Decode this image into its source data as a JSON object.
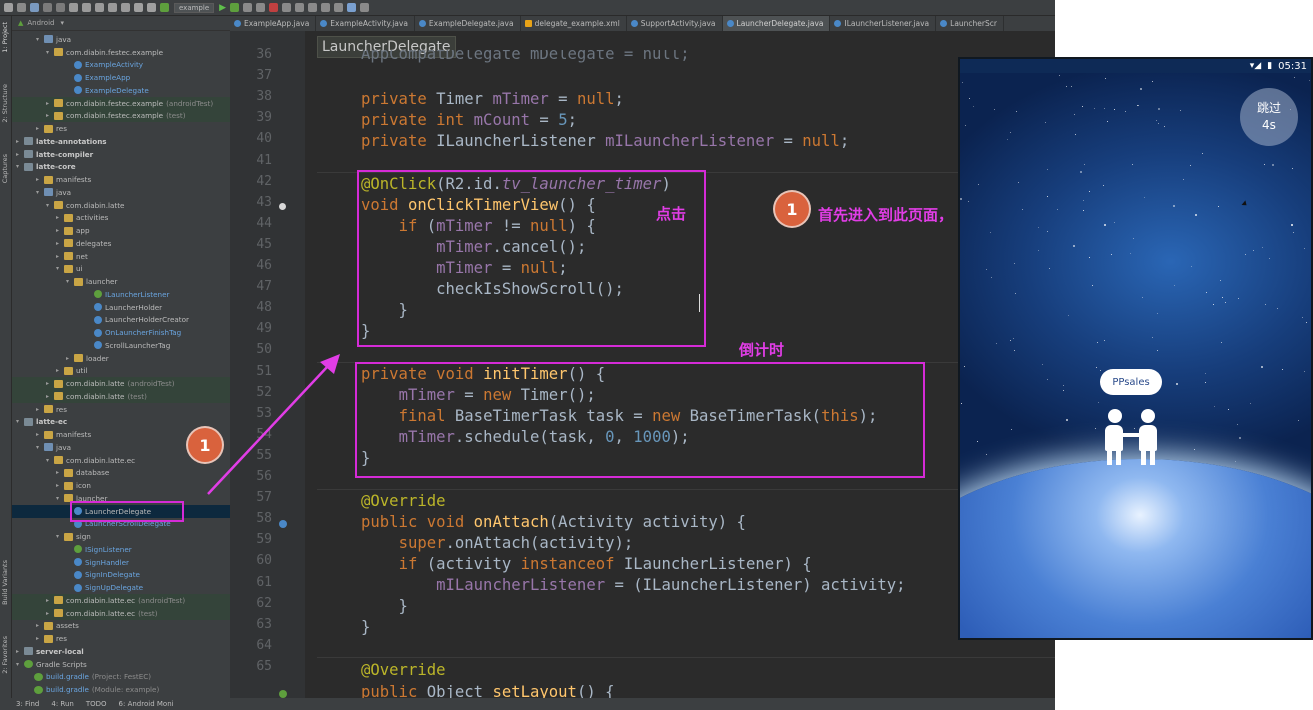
{
  "toolbar": {
    "project": "example"
  },
  "tabs": [
    {
      "label": "ExampleApp.java",
      "kind": "java"
    },
    {
      "label": "ExampleActivity.java",
      "kind": "java"
    },
    {
      "label": "ExampleDelegate.java",
      "kind": "java"
    },
    {
      "label": "delegate_example.xml",
      "kind": "xml"
    },
    {
      "label": "SupportActivity.java",
      "kind": "java"
    },
    {
      "label": "LauncherDelegate.java",
      "kind": "java",
      "active": true
    },
    {
      "label": "ILauncherListener.java",
      "kind": "java"
    },
    {
      "label": "LauncherScr",
      "kind": "java"
    }
  ],
  "left_strip": {
    "project": "1: Project",
    "structure": "2: Structure",
    "captures": "Captures",
    "build_variants": "Build Variants",
    "favorites": "2: Favorites"
  },
  "project_header": "Android",
  "tree": [
    {
      "label": "java",
      "depth": 2,
      "icon": "folder-blue",
      "exp": "down"
    },
    {
      "label": "com.diabin.festec.example",
      "depth": 3,
      "icon": "folder",
      "exp": "down"
    },
    {
      "label": "ExampleActivity",
      "depth": 5,
      "icon": "class",
      "color": "blue"
    },
    {
      "label": "ExampleApp",
      "depth": 5,
      "icon": "class",
      "color": "blue"
    },
    {
      "label": "ExampleDelegate",
      "depth": 5,
      "icon": "class",
      "color": "blue"
    },
    {
      "label": "com.diabin.festec.example",
      "suffix": "(androidTest)",
      "depth": 3,
      "icon": "folder",
      "exp": "right",
      "bg": "test"
    },
    {
      "label": "com.diabin.festec.example",
      "suffix": "(test)",
      "depth": 3,
      "icon": "folder",
      "exp": "right",
      "bg": "test"
    },
    {
      "label": "res",
      "depth": 2,
      "icon": "folder",
      "exp": "right"
    },
    {
      "label": "latte-annotations",
      "depth": 0,
      "icon": "module",
      "exp": "right",
      "bold": true
    },
    {
      "label": "latte-compiler",
      "depth": 0,
      "icon": "module",
      "exp": "right",
      "bold": true
    },
    {
      "label": "latte-core",
      "depth": 0,
      "icon": "module",
      "exp": "down",
      "bold": true
    },
    {
      "label": "manifests",
      "depth": 2,
      "icon": "folder",
      "exp": "right"
    },
    {
      "label": "java",
      "depth": 2,
      "icon": "folder-blue",
      "exp": "down"
    },
    {
      "label": "com.diabin.latte",
      "depth": 3,
      "icon": "folder",
      "exp": "down"
    },
    {
      "label": "activities",
      "depth": 4,
      "icon": "folder",
      "exp": "right"
    },
    {
      "label": "app",
      "depth": 4,
      "icon": "folder",
      "exp": "right"
    },
    {
      "label": "delegates",
      "depth": 4,
      "icon": "folder",
      "exp": "right"
    },
    {
      "label": "net",
      "depth": 4,
      "icon": "folder",
      "exp": "right"
    },
    {
      "label": "ui",
      "depth": 4,
      "icon": "folder",
      "exp": "down"
    },
    {
      "label": "launcher",
      "depth": 5,
      "icon": "folder",
      "exp": "down"
    },
    {
      "label": "ILauncherListener",
      "depth": 7,
      "icon": "interface",
      "color": "blue"
    },
    {
      "label": "LauncherHolder",
      "depth": 7,
      "icon": "class"
    },
    {
      "label": "LauncherHolderCreator",
      "depth": 7,
      "icon": "class"
    },
    {
      "label": "OnLauncherFinishTag",
      "depth": 7,
      "icon": "class",
      "color": "blue"
    },
    {
      "label": "ScrollLauncherTag",
      "depth": 7,
      "icon": "class"
    },
    {
      "label": "loader",
      "depth": 5,
      "icon": "folder",
      "exp": "right"
    },
    {
      "label": "util",
      "depth": 4,
      "icon": "folder",
      "exp": "right"
    },
    {
      "label": "com.diabin.latte",
      "suffix": "(androidTest)",
      "depth": 3,
      "icon": "folder",
      "exp": "right",
      "bg": "test"
    },
    {
      "label": "com.diabin.latte",
      "suffix": "(test)",
      "depth": 3,
      "icon": "folder",
      "exp": "right",
      "bg": "test"
    },
    {
      "label": "res",
      "depth": 2,
      "icon": "folder",
      "exp": "right"
    },
    {
      "label": "latte-ec",
      "depth": 0,
      "icon": "module",
      "exp": "down",
      "bold": true
    },
    {
      "label": "manifests",
      "depth": 2,
      "icon": "folder",
      "exp": "right"
    },
    {
      "label": "java",
      "depth": 2,
      "icon": "folder-blue",
      "exp": "down"
    },
    {
      "label": "com.diabin.latte.ec",
      "depth": 3,
      "icon": "folder",
      "exp": "down"
    },
    {
      "label": "database",
      "depth": 4,
      "icon": "folder",
      "exp": "right"
    },
    {
      "label": "icon",
      "depth": 4,
      "icon": "folder",
      "exp": "right"
    },
    {
      "label": "launcher",
      "depth": 4,
      "icon": "folder",
      "exp": "down"
    },
    {
      "label": "LauncherDelegate",
      "depth": 5,
      "icon": "class",
      "selected": true
    },
    {
      "label": "LauncherScrollDelegate",
      "depth": 5,
      "icon": "class",
      "color": "blue"
    },
    {
      "label": "sign",
      "depth": 4,
      "icon": "folder",
      "exp": "down"
    },
    {
      "label": "ISignListener",
      "depth": 5,
      "icon": "interface",
      "color": "blue"
    },
    {
      "label": "SignHandler",
      "depth": 5,
      "icon": "class",
      "color": "blue"
    },
    {
      "label": "SignInDelegate",
      "depth": 5,
      "icon": "class",
      "color": "blue"
    },
    {
      "label": "SignUpDelegate",
      "depth": 5,
      "icon": "class",
      "color": "blue"
    },
    {
      "label": "com.diabin.latte.ec",
      "suffix": "(androidTest)",
      "depth": 3,
      "icon": "folder",
      "exp": "right",
      "bg": "test"
    },
    {
      "label": "com.diabin.latte.ec",
      "suffix": "(test)",
      "depth": 3,
      "icon": "folder",
      "exp": "right",
      "bg": "test"
    },
    {
      "label": "assets",
      "depth": 2,
      "icon": "folder",
      "exp": "right"
    },
    {
      "label": "res",
      "depth": 2,
      "icon": "folder",
      "exp": "right"
    },
    {
      "label": "server-local",
      "depth": 0,
      "icon": "module",
      "exp": "right",
      "bold": true
    },
    {
      "label": "Gradle Scripts",
      "depth": 0,
      "icon": "gradle",
      "exp": "down"
    },
    {
      "label": "build.gradle",
      "suffix": "(Project: FestEC)",
      "depth": 1,
      "icon": "gradle"
    },
    {
      "label": "build.gradle",
      "suffix": "(Module: example)",
      "depth": 1,
      "icon": "gradle"
    }
  ],
  "bottom_bar": {
    "find": "3: Find",
    "run": "4: Run",
    "todo": "TODO",
    "monitor": "6: Android Moni"
  },
  "editor": {
    "breadcrumb": "LauncherDelegate",
    "line_numbers": [
      "36",
      "37",
      "38",
      "39",
      "40",
      "41",
      "42",
      "43",
      "44",
      "45",
      "46",
      "47",
      "48",
      "49",
      "50",
      "51",
      "52",
      "53",
      "54",
      "55",
      "56",
      "57",
      "58",
      "59",
      "60",
      "61",
      "62",
      "63",
      "64",
      "65"
    ],
    "partial_top_line": "AppCompatDelegate mDelegate = null;"
  },
  "annotations": {
    "click_label": "点击",
    "countdown_label": "倒计时",
    "first_enter_label": "首先进入到此页面，",
    "badge_number": "1"
  },
  "phone": {
    "time": "05:31",
    "skip_label": "跳过",
    "skip_count": "4s",
    "bubble_text": "PPsales"
  },
  "colors": {
    "annotation": "#d52bd7",
    "badge": "#d9623d",
    "keyword": "#cc7832",
    "field": "#9876aa",
    "method": "#ffc66d",
    "number": "#6897bb",
    "annotation_code": "#bbb529"
  }
}
